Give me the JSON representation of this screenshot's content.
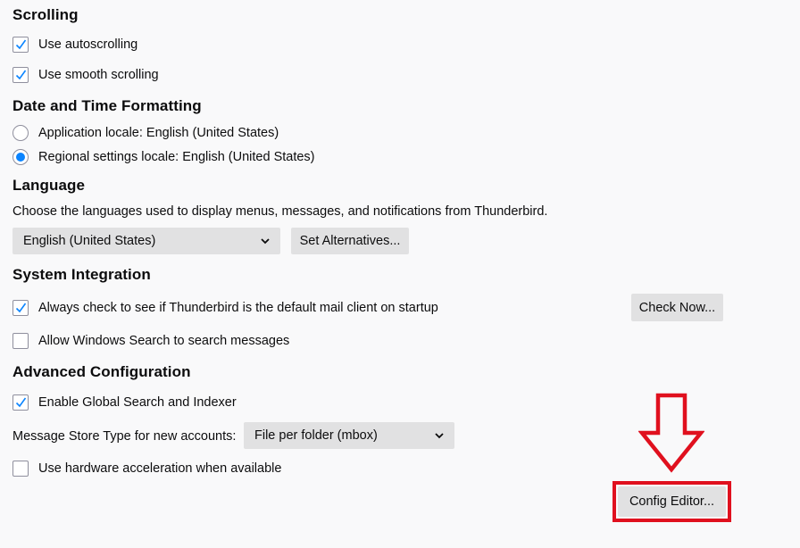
{
  "scrolling": {
    "heading": "Scrolling",
    "autoscroll_label": "Use autoscrolling",
    "autoscroll_checked": true,
    "smooth_label": "Use smooth scrolling",
    "smooth_checked": true
  },
  "datetime": {
    "heading": "Date and Time Formatting",
    "app_locale_label": "Application locale: English (United States)",
    "regional_locale_label": "Regional settings locale: English (United States)",
    "selected": "regional"
  },
  "language": {
    "heading": "Language",
    "description": "Choose the languages used to display menus, messages, and notifications from Thunderbird.",
    "selected_language": "English (United States)",
    "alternatives_button": "Set Alternatives..."
  },
  "system": {
    "heading": "System Integration",
    "default_check_label": "Always check to see if Thunderbird is the default mail client on startup",
    "default_check_checked": true,
    "check_now_button": "Check Now...",
    "windows_search_label": "Allow Windows Search to search messages",
    "windows_search_checked": false
  },
  "advanced": {
    "heading": "Advanced Configuration",
    "global_search_label": "Enable Global Search and Indexer",
    "global_search_checked": true,
    "store_type_label": "Message Store Type for new accounts:",
    "store_type_value": "File per folder (mbox)",
    "hw_accel_label": "Use hardware acceleration when available",
    "hw_accel_checked": false,
    "config_editor_button": "Config Editor..."
  },
  "colors": {
    "accent": "#0a84ff",
    "highlight_red": "#e0101e"
  },
  "icons": {
    "checkmark": "checkmark-icon",
    "dropdown": "chevron-down-icon",
    "annotation_arrow": "down-arrow-annotation-icon"
  }
}
